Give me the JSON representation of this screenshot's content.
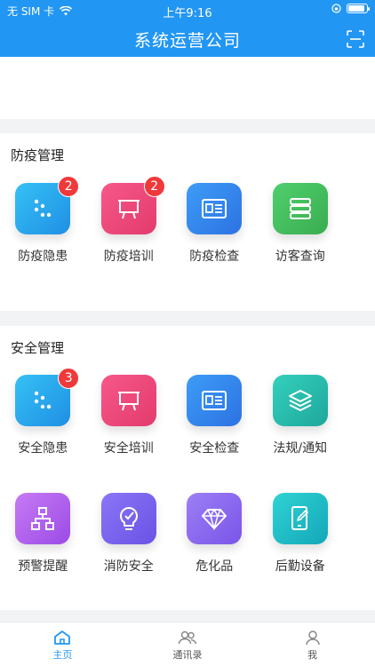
{
  "status_bar": {
    "carrier": "无 SIM 卡",
    "time": "上午9:16",
    "battery_level": 0.9
  },
  "navbar": {
    "title": "系统运营公司",
    "scan_icon": "scan-icon"
  },
  "colors": {
    "primary": "#2296f3",
    "badge": "#f0393b"
  },
  "epidemic": {
    "title": "防疫管理",
    "items": [
      {
        "label": "防疫隐患",
        "badge": "2",
        "icon": "dots-icon"
      },
      {
        "label": "防疫培训",
        "badge": "2",
        "icon": "presentation-board-icon"
      },
      {
        "label": "防疫检查",
        "badge": "",
        "icon": "id-card-icon"
      },
      {
        "label": "访客查询",
        "badge": "",
        "icon": "database-stack-icon"
      }
    ]
  },
  "safety": {
    "title": "安全管理",
    "items": [
      {
        "label": "安全隐患",
        "badge": "3",
        "icon": "dots-icon"
      },
      {
        "label": "安全培训",
        "badge": "",
        "icon": "presentation-board-icon"
      },
      {
        "label": "安全检查",
        "badge": "",
        "icon": "id-card-icon"
      },
      {
        "label": "法规/通知",
        "badge": "",
        "icon": "layers-icon"
      },
      {
        "label": "预警提醒",
        "badge": "",
        "icon": "hierarchy-icon"
      },
      {
        "label": "消防安全",
        "badge": "",
        "icon": "lightbulb-icon"
      },
      {
        "label": "危化品",
        "badge": "",
        "icon": "diamond-icon"
      },
      {
        "label": "后勤设备",
        "badge": "",
        "icon": "tablet-edit-icon"
      }
    ]
  },
  "tabbar": {
    "items": [
      {
        "label": "主页",
        "icon": "home-icon",
        "active": true
      },
      {
        "label": "通讯录",
        "icon": "contacts-icon",
        "active": false
      },
      {
        "label": "我",
        "icon": "user-icon",
        "active": false
      }
    ]
  }
}
